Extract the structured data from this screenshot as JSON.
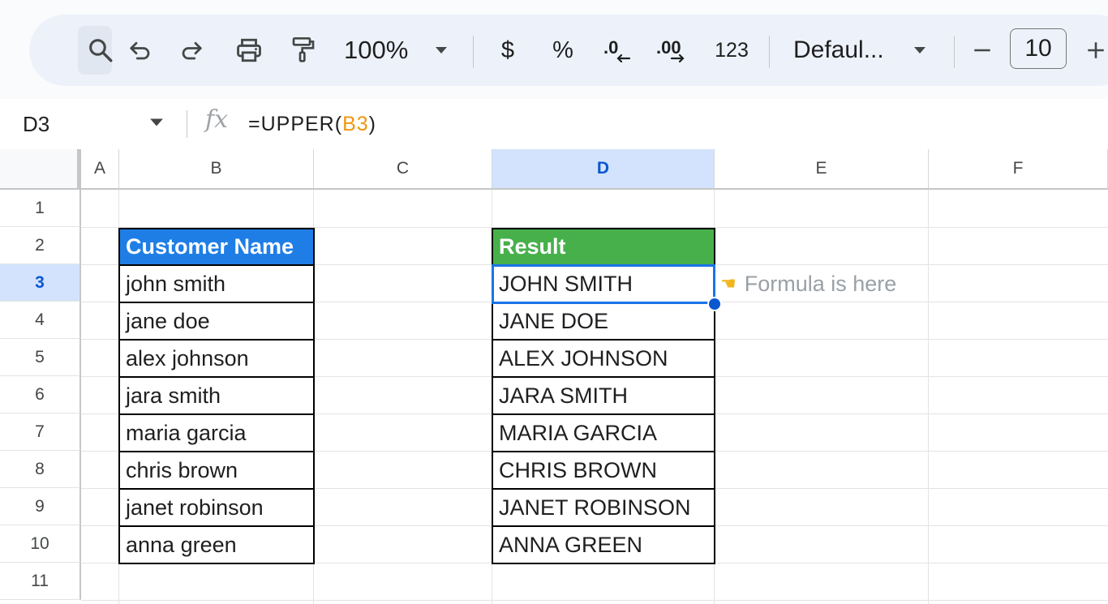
{
  "toolbar": {
    "zoom": "100%",
    "currency": "$",
    "percent": "%",
    "decrease_decimal": ".0",
    "increase_decimal": ".00",
    "more_formats": "123",
    "font": "Defaul...",
    "font_size": "10"
  },
  "formula_bar": {
    "cell_ref": "D3",
    "formula_prefix": "=UPPER(",
    "formula_ref": "B3",
    "formula_suffix": ")"
  },
  "columns": [
    "A",
    "B",
    "C",
    "D",
    "E",
    "F"
  ],
  "rows": [
    "1",
    "2",
    "3",
    "4",
    "5",
    "6",
    "7",
    "8",
    "9",
    "10",
    "11"
  ],
  "table": {
    "name_header": "Customer Name",
    "result_header": "Result",
    "names": [
      "john smith",
      "jane doe",
      "alex johnson",
      "jara smith",
      "maria garcia",
      "chris brown",
      "janet robinson",
      "anna green"
    ],
    "results": [
      "JOHN SMITH",
      "JANE DOE",
      "ALEX JOHNSON",
      "JARA SMITH",
      "MARIA GARCIA",
      "CHRIS BROWN",
      "JANET ROBINSON",
      "ANNA GREEN"
    ]
  },
  "annotation": {
    "icon": "pointing-hand-icon",
    "text": "Formula is here"
  },
  "colors": {
    "name_header_bg": "#1e7ee6",
    "result_header_bg": "#47b04b",
    "selection": "#1a73e8",
    "formula_ref": "#f0960e"
  }
}
